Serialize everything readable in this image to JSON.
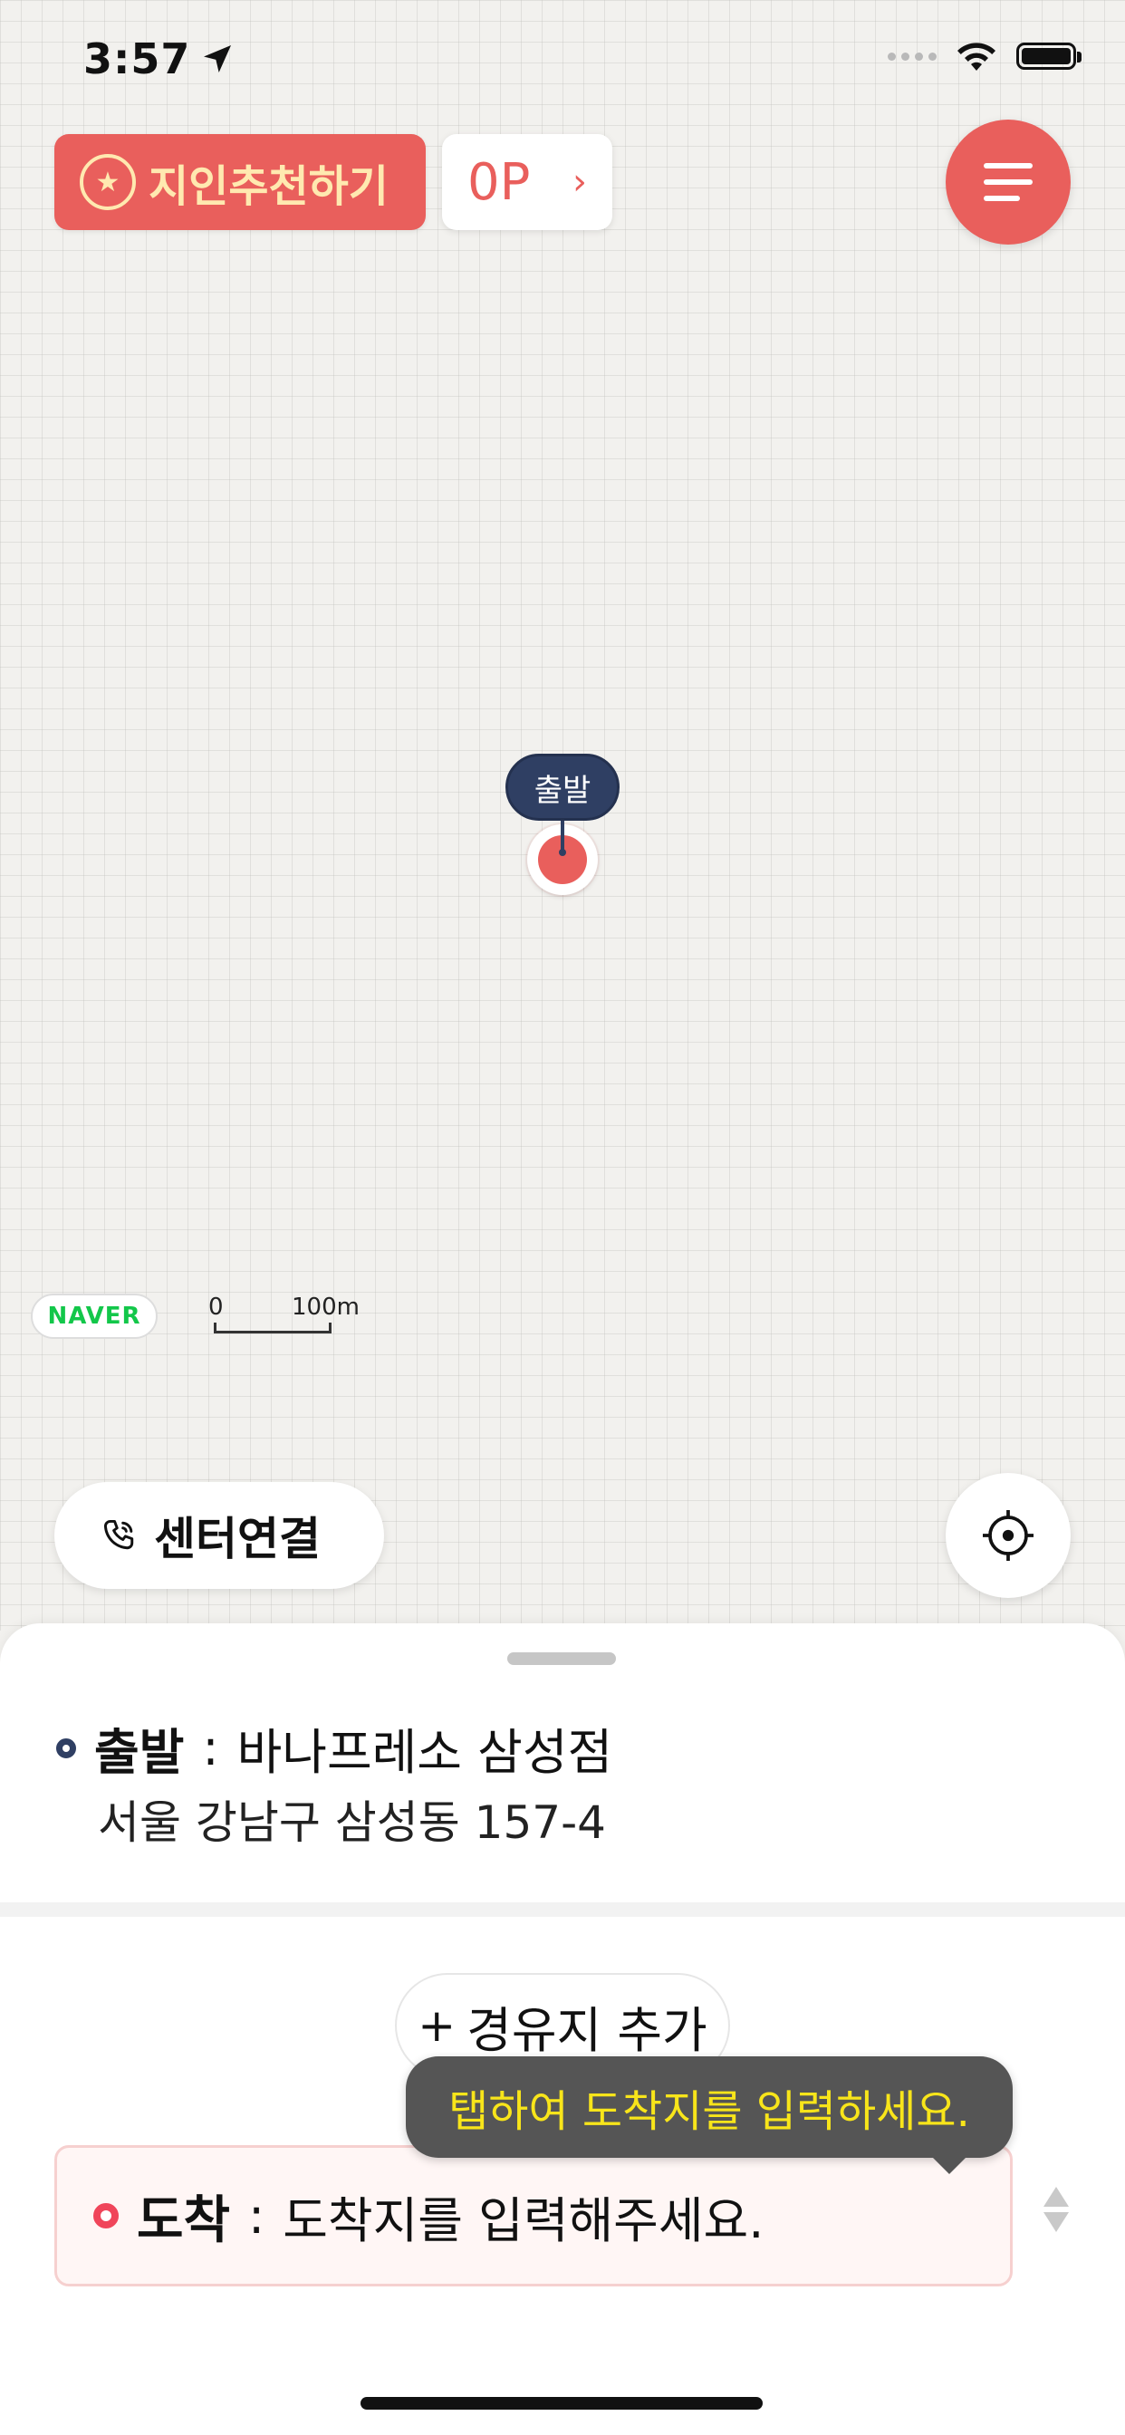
{
  "status_bar": {
    "time": "3:57"
  },
  "top_bar": {
    "referral_label": "지인추천하기",
    "points_value": "0P",
    "points_chevron": "›"
  },
  "map": {
    "marker_label": "출발",
    "naver_logo": "NAVER",
    "scale_zero": "0",
    "scale_distance": "100m"
  },
  "actions": {
    "center_connect_label": "센터연결"
  },
  "route": {
    "origin": {
      "title": "출발",
      "separator": ":",
      "name": "바나프레소 삼성점",
      "address": "서울 강남구 삼성동 157-4"
    },
    "waypoint_add": {
      "plus": "+",
      "label": "경유지 추가"
    },
    "tooltip": "탭하여 도착지를 입력하세요.",
    "destination": {
      "title": "도착",
      "separator": ":",
      "placeholder": "도착지를 입력해주세요."
    }
  },
  "colors": {
    "accent": "#e95f5c",
    "navy": "#2f3f63",
    "tooltip_text": "#f8e51a",
    "naver_green": "#13c74a"
  },
  "icons": {
    "location-arrow": "location-arrow-icon",
    "wifi": "wifi-icon",
    "battery": "battery-icon",
    "menu": "hamburger-menu-icon",
    "phone": "phone-icon",
    "locate": "crosshair-icon",
    "badge": "star-badge-icon"
  }
}
